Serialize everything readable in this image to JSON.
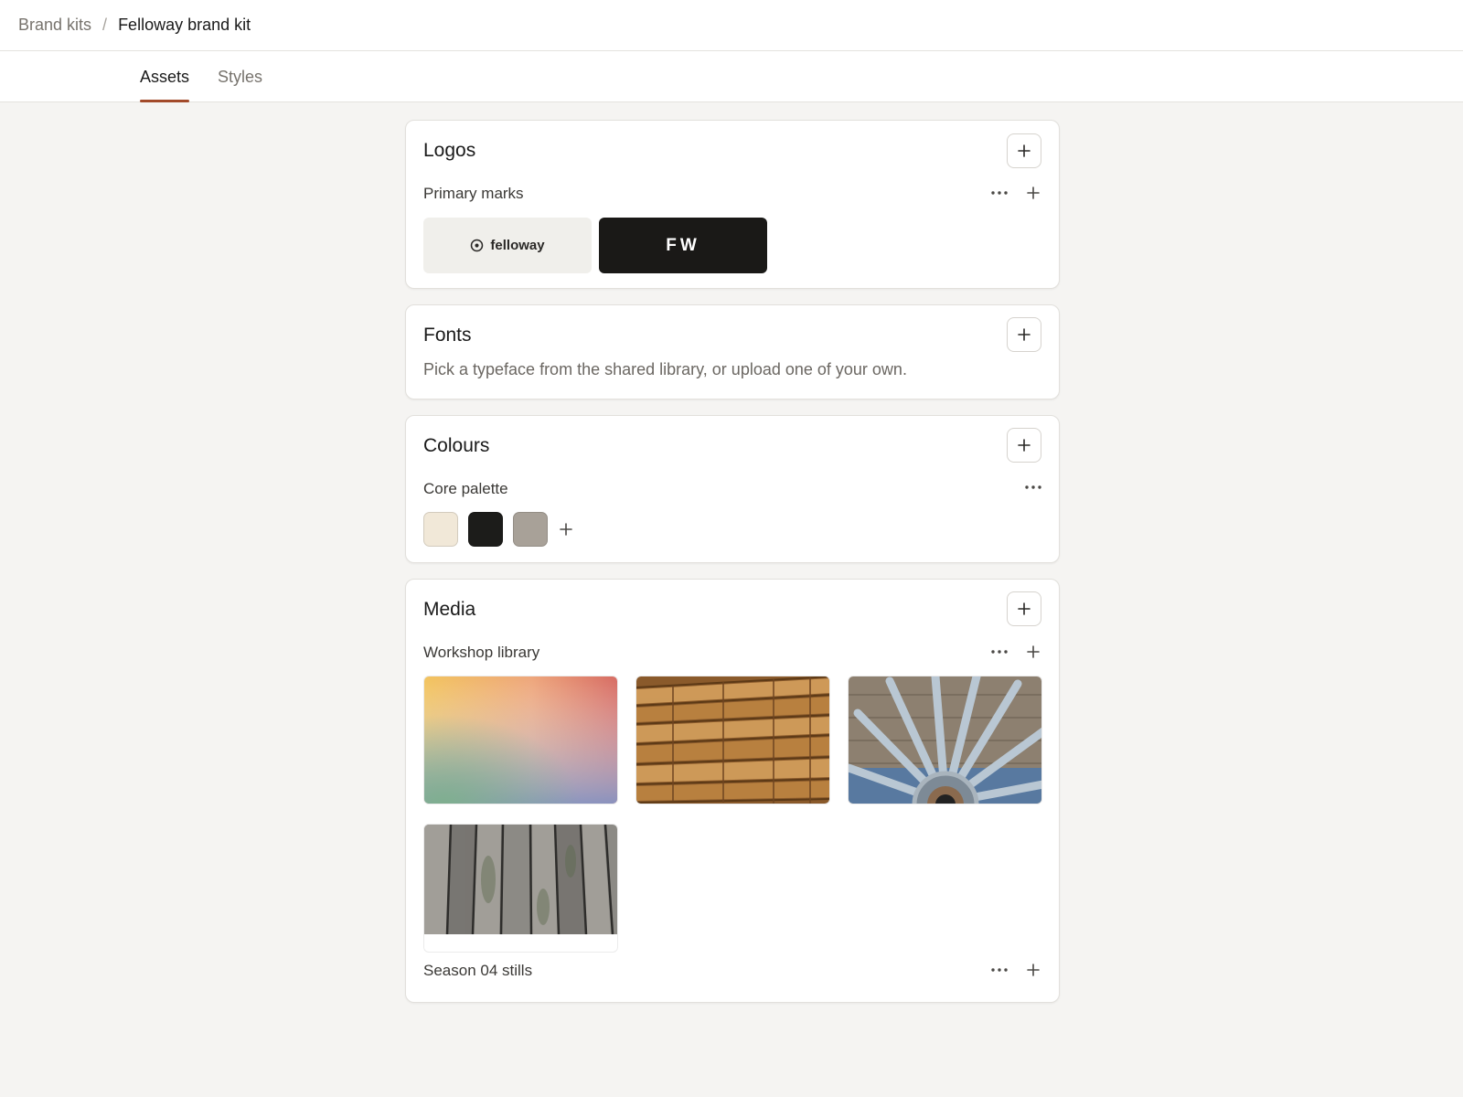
{
  "breadcrumb": {
    "parent": "Brand kits",
    "separator": "/",
    "current": "Felloway brand kit"
  },
  "tabs": [
    {
      "label": "Assets",
      "active": true
    },
    {
      "label": "Styles",
      "active": false
    }
  ],
  "accent_color": "#a24a2a",
  "logos": {
    "title": "Logos",
    "group_label": "Primary marks",
    "items": [
      {
        "type": "wordmark",
        "text": "felloway",
        "icon": "circle-dot-icon",
        "background": "#f0efeb"
      },
      {
        "type": "monogram",
        "text": "FW",
        "background": "#1a1917"
      }
    ]
  },
  "fonts": {
    "title": "Fonts",
    "description": "Pick a typeface from the shared library, or upload one of your own."
  },
  "colours": {
    "title": "Colours",
    "group_label": "Core palette",
    "swatches": [
      "#f1e8d8",
      "#1c1c1a",
      "#a8a198"
    ]
  },
  "media": {
    "title": "Media",
    "groups": [
      {
        "label": "Workshop library",
        "images": [
          "gradient",
          "stacked-lumber",
          "wagon-wheel",
          "weathered-planks"
        ]
      },
      {
        "label": "Season 04 stills",
        "images": []
      }
    ]
  }
}
